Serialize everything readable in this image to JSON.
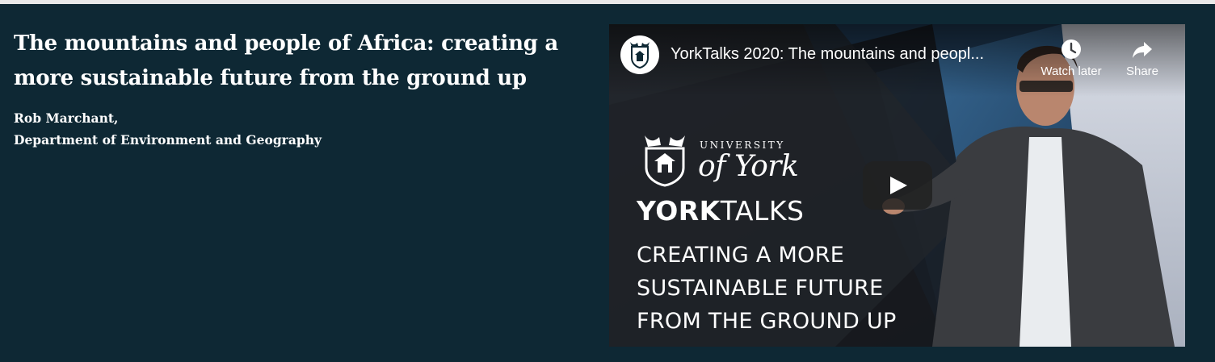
{
  "article": {
    "title": "The mountains and people of Africa: creating a more sustainable future from the ground up",
    "author_name": "Rob Marchant,",
    "author_department": "Department of Environment and Geography"
  },
  "video": {
    "title": "YorkTalks 2020: The mountains and peopl...",
    "watch_later_label": "Watch later",
    "share_label": "Share",
    "thumbnail": {
      "university_line1": "UNIVERSITY",
      "university_line2": "of York",
      "brand_bold": "YORK",
      "brand_light": "TALKS",
      "headline": [
        "CREATING A MORE",
        "SUSTAINABLE FUTURE",
        "FROM THE GROUND UP"
      ]
    }
  },
  "colors": {
    "panel_background": "#0e2834",
    "text": "#ffffff",
    "play_button": "#212121"
  },
  "icons": {
    "watch_later": "clock-icon",
    "share": "share-arrow-icon",
    "play": "play-icon",
    "channel": "university-crest-icon"
  }
}
